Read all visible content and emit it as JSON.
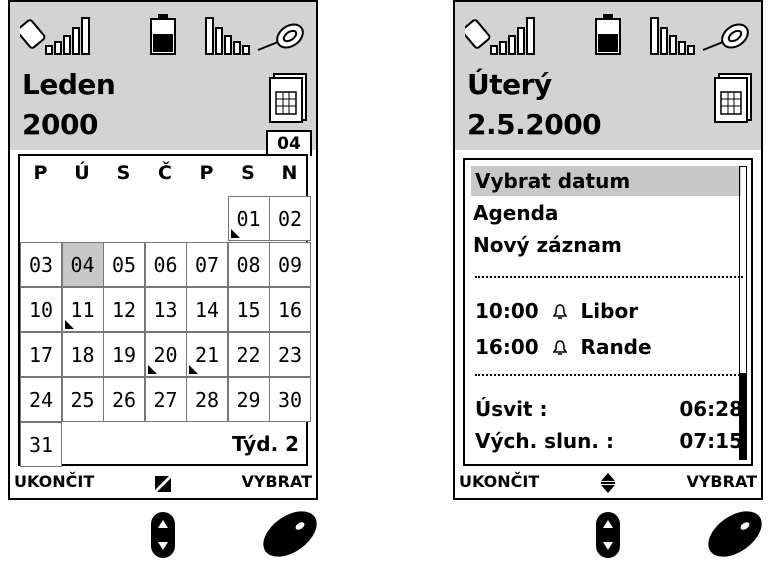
{
  "left": {
    "title_line1": "Leden",
    "title_line2": "2000",
    "week_tab": "04",
    "weekdays": [
      "P",
      "Ú",
      "S",
      "Č",
      "P",
      "S",
      "N"
    ],
    "rows": [
      [
        null,
        null,
        null,
        null,
        null,
        {
          "d": "01",
          "m": true
        },
        {
          "d": "02"
        }
      ],
      [
        {
          "d": "03"
        },
        {
          "d": "04",
          "sel": true
        },
        {
          "d": "05"
        },
        {
          "d": "06"
        },
        {
          "d": "07"
        },
        {
          "d": "08"
        },
        {
          "d": "09"
        }
      ],
      [
        {
          "d": "10"
        },
        {
          "d": "11",
          "m": true
        },
        {
          "d": "12"
        },
        {
          "d": "13"
        },
        {
          "d": "14"
        },
        {
          "d": "15"
        },
        {
          "d": "16"
        }
      ],
      [
        {
          "d": "17"
        },
        {
          "d": "18"
        },
        {
          "d": "19"
        },
        {
          "d": "20",
          "m": true
        },
        {
          "d": "21",
          "m": true
        },
        {
          "d": "22"
        },
        {
          "d": "23"
        }
      ],
      [
        {
          "d": "24"
        },
        {
          "d": "25"
        },
        {
          "d": "26"
        },
        {
          "d": "27"
        },
        {
          "d": "28"
        },
        {
          "d": "29"
        },
        {
          "d": "30"
        }
      ],
      [
        {
          "d": "31"
        },
        null,
        null,
        null,
        null,
        null,
        null
      ]
    ],
    "week_label": "Týd. 2",
    "softkey_left": "UKONČIT",
    "softkey_right": "VYBRAT"
  },
  "right": {
    "title_line1": "Úterý",
    "title_line2": "2.5.2000",
    "menu": [
      "Vybrat datum",
      "Agenda",
      "Nový záznam"
    ],
    "events": [
      {
        "time": "10:00",
        "name": "Libor"
      },
      {
        "time": "16:00",
        "name": "Rande"
      }
    ],
    "info": [
      {
        "label": "Úsvit :",
        "value": "06:28"
      },
      {
        "label": "Vých. slun. :",
        "value": "07:15"
      }
    ],
    "softkey_left": "UKONČIT",
    "softkey_right": "VYBRAT"
  }
}
